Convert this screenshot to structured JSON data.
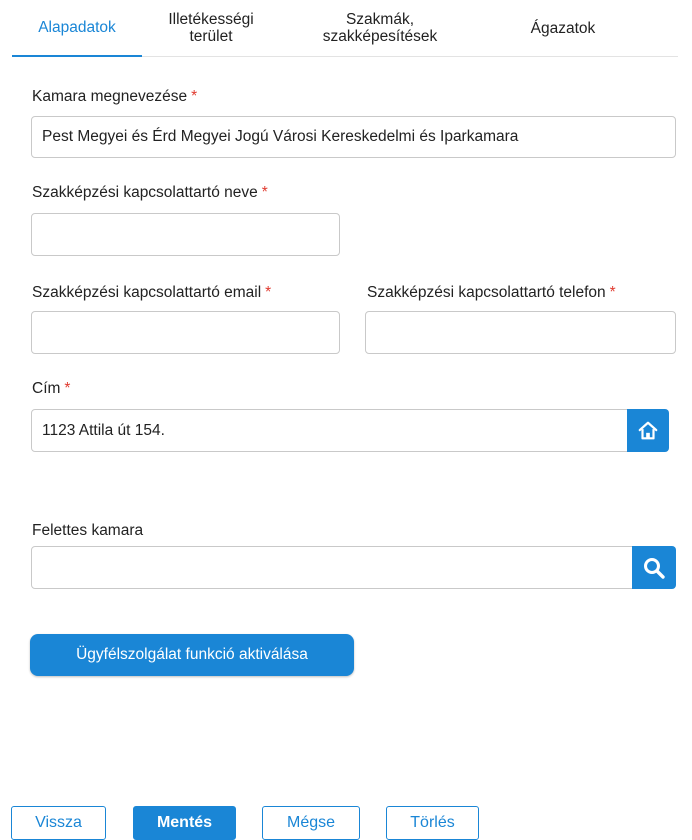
{
  "tabs": [
    {
      "label": "Alapadatok",
      "active": true
    },
    {
      "label_line1": "Illetékességi",
      "label_line2": "terület"
    },
    {
      "label_line1": "Szakmák,",
      "label_line2": "szakképesítések"
    },
    {
      "label": "Ágazatok"
    }
  ],
  "form": {
    "chamber_name": {
      "label": "Kamara megnevezése",
      "required_mark": "*",
      "value": "Pest Megyei és Érd Megyei Jogú Városi Kereskedelmi és Iparkamara"
    },
    "contact_name": {
      "label": "Szakképzési kapcsolattartó neve",
      "required_mark": "*",
      "value": ""
    },
    "contact_email": {
      "label": "Szakképzési kapcsolattartó email",
      "required_mark": "*",
      "value": ""
    },
    "contact_phone": {
      "label": "Szakképzési kapcsolattartó telefon",
      "required_mark": "*",
      "value": ""
    },
    "address": {
      "label": "Cím",
      "required_mark": "*",
      "value": "1123 Attila út 154.",
      "button_icon": "home-icon"
    },
    "parent_chamber": {
      "label": "Felettes kamara",
      "value": "",
      "button_icon": "search-icon"
    }
  },
  "activate_button": {
    "label": "Ügyfélszolgálat funkció aktiválása"
  },
  "footer": {
    "back": "Vissza",
    "save": "Mentés",
    "cancel": "Mégse",
    "delete": "Törlés"
  },
  "colors": {
    "accent": "#1a86d6",
    "required": "#e03a2f"
  }
}
